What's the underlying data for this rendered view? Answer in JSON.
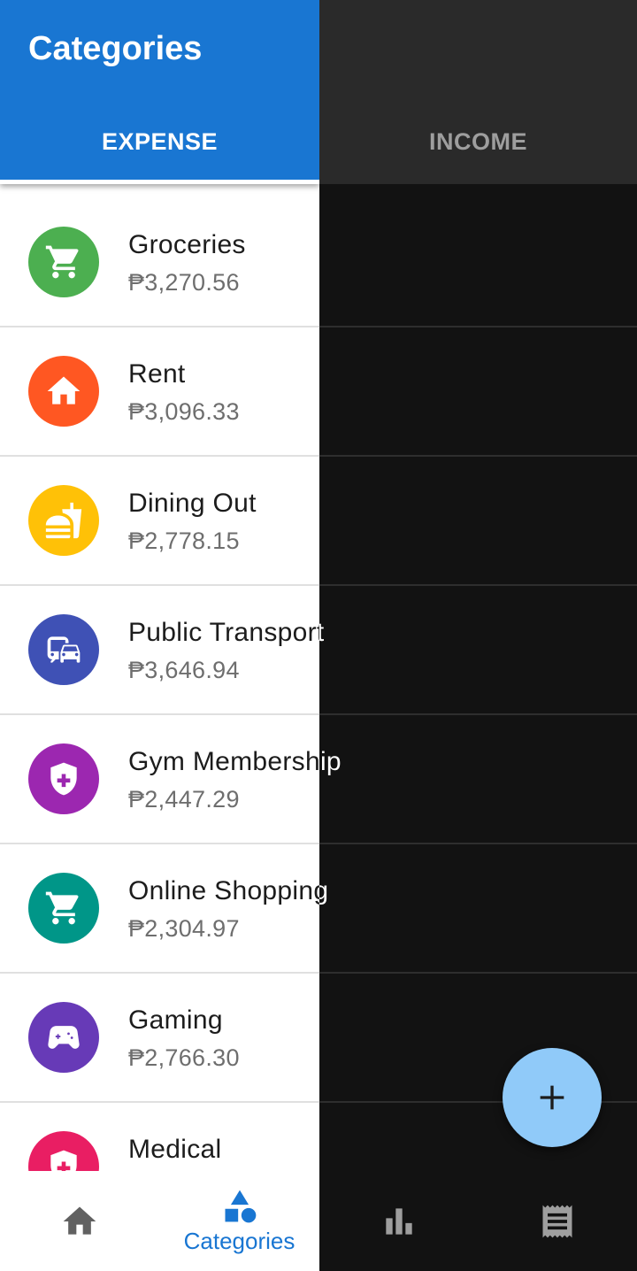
{
  "app": {
    "title": "Categories"
  },
  "tabs": {
    "expense_label": "EXPENSE",
    "income_label": "INCOME",
    "active": "EXPENSE"
  },
  "categories": [
    {
      "name": "Groceries",
      "amount": "₱3,270.56",
      "color": "#4caf50",
      "icon": "shopping-cart-icon"
    },
    {
      "name": "Rent",
      "amount": "₱3,096.33",
      "color": "#ff5722",
      "icon": "home-icon"
    },
    {
      "name": "Dining Out",
      "amount": "₱2,778.15",
      "color": "#ffc107",
      "icon": "fastfood-icon"
    },
    {
      "name": "Public Transport",
      "amount": "₱3,646.94",
      "color": "#3f51b5",
      "icon": "commute-icon"
    },
    {
      "name": "Gym Membership",
      "amount": "₱2,447.29",
      "color": "#9c27b0",
      "icon": "health-shield-icon"
    },
    {
      "name": "Online Shopping",
      "amount": "₱2,304.97",
      "color": "#009688",
      "icon": "shopping-cart-icon"
    },
    {
      "name": "Gaming",
      "amount": "₱2,766.30",
      "color": "#673ab7",
      "icon": "gamepad-icon"
    },
    {
      "name": "Medical",
      "amount": "",
      "color": "#e91e63",
      "icon": "health-shield-icon"
    }
  ],
  "bottom_nav": {
    "items": [
      {
        "icon": "home-icon",
        "label": ""
      },
      {
        "icon": "categories-icon",
        "label": "Categories"
      },
      {
        "icon": "bar-chart-icon",
        "label": ""
      },
      {
        "icon": "receipt-icon",
        "label": ""
      }
    ],
    "active": "Categories"
  },
  "fab": {
    "icon": "plus-icon"
  },
  "colors": {
    "primary": "#1976d2",
    "fab": "#90caf9",
    "dark_bg": "#121212",
    "dark_appbar": "#2a2a2a"
  }
}
